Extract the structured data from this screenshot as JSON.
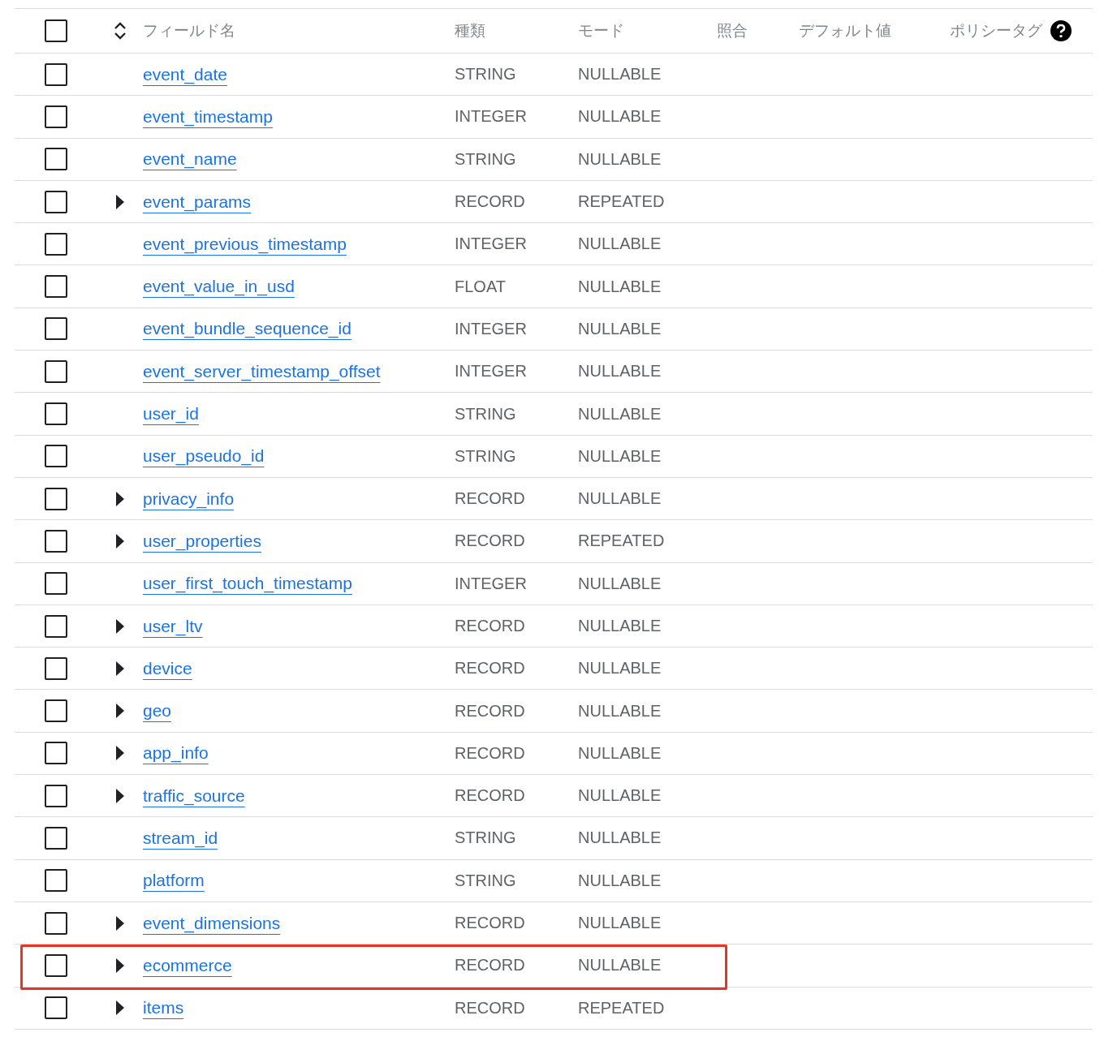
{
  "table": {
    "header": {
      "checked": false,
      "columns": [
        "フィールド名",
        "種類",
        "モード",
        "照合",
        "デフォルト値",
        "ポリシータグ"
      ]
    },
    "rows": [
      {
        "name": "event_date",
        "type": "STRING",
        "mode": "NULLABLE",
        "expandable": false,
        "checked": false,
        "highlighted": false
      },
      {
        "name": "event_timestamp",
        "type": "INTEGER",
        "mode": "NULLABLE",
        "expandable": false,
        "checked": false,
        "highlighted": false
      },
      {
        "name": "event_name",
        "type": "STRING",
        "mode": "NULLABLE",
        "expandable": false,
        "checked": false,
        "highlighted": false
      },
      {
        "name": "event_params",
        "type": "RECORD",
        "mode": "REPEATED",
        "expandable": true,
        "checked": false,
        "highlighted": false
      },
      {
        "name": "event_previous_timestamp",
        "type": "INTEGER",
        "mode": "NULLABLE",
        "expandable": false,
        "checked": false,
        "highlighted": false
      },
      {
        "name": "event_value_in_usd",
        "type": "FLOAT",
        "mode": "NULLABLE",
        "expandable": false,
        "checked": false,
        "highlighted": false
      },
      {
        "name": "event_bundle_sequence_id",
        "type": "INTEGER",
        "mode": "NULLABLE",
        "expandable": false,
        "checked": false,
        "highlighted": false
      },
      {
        "name": "event_server_timestamp_offset",
        "type": "INTEGER",
        "mode": "NULLABLE",
        "expandable": false,
        "checked": false,
        "highlighted": false
      },
      {
        "name": "user_id",
        "type": "STRING",
        "mode": "NULLABLE",
        "expandable": false,
        "checked": false,
        "highlighted": false
      },
      {
        "name": "user_pseudo_id",
        "type": "STRING",
        "mode": "NULLABLE",
        "expandable": false,
        "checked": false,
        "highlighted": false
      },
      {
        "name": "privacy_info",
        "type": "RECORD",
        "mode": "NULLABLE",
        "expandable": true,
        "checked": false,
        "highlighted": false
      },
      {
        "name": "user_properties",
        "type": "RECORD",
        "mode": "REPEATED",
        "expandable": true,
        "checked": false,
        "highlighted": false
      },
      {
        "name": "user_first_touch_timestamp",
        "type": "INTEGER",
        "mode": "NULLABLE",
        "expandable": false,
        "checked": false,
        "highlighted": false
      },
      {
        "name": "user_ltv",
        "type": "RECORD",
        "mode": "NULLABLE",
        "expandable": true,
        "checked": false,
        "highlighted": false
      },
      {
        "name": "device",
        "type": "RECORD",
        "mode": "NULLABLE",
        "expandable": true,
        "checked": false,
        "highlighted": false
      },
      {
        "name": "geo",
        "type": "RECORD",
        "mode": "NULLABLE",
        "expandable": true,
        "checked": false,
        "highlighted": false
      },
      {
        "name": "app_info",
        "type": "RECORD",
        "mode": "NULLABLE",
        "expandable": true,
        "checked": false,
        "highlighted": false
      },
      {
        "name": "traffic_source",
        "type": "RECORD",
        "mode": "NULLABLE",
        "expandable": true,
        "checked": false,
        "highlighted": false
      },
      {
        "name": "stream_id",
        "type": "STRING",
        "mode": "NULLABLE",
        "expandable": false,
        "checked": false,
        "highlighted": false
      },
      {
        "name": "platform",
        "type": "STRING",
        "mode": "NULLABLE",
        "expandable": false,
        "checked": false,
        "highlighted": false
      },
      {
        "name": "event_dimensions",
        "type": "RECORD",
        "mode": "NULLABLE",
        "expandable": true,
        "checked": false,
        "highlighted": false
      },
      {
        "name": "ecommerce",
        "type": "RECORD",
        "mode": "NULLABLE",
        "expandable": true,
        "checked": false,
        "highlighted": true
      },
      {
        "name": "items",
        "type": "RECORD",
        "mode": "REPEATED",
        "expandable": true,
        "checked": false,
        "highlighted": false
      }
    ]
  }
}
